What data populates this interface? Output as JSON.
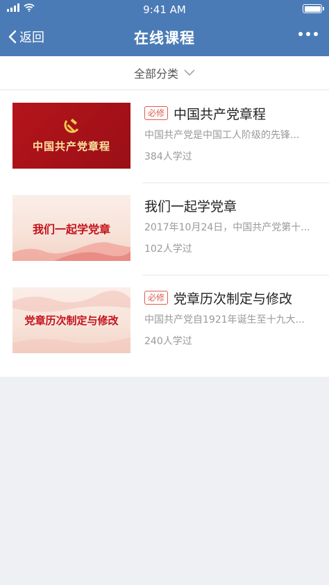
{
  "status": {
    "time": "9:41 AM"
  },
  "nav": {
    "back_label": "返回",
    "title": "在线课程"
  },
  "filter": {
    "label": "全部分类"
  },
  "courses": [
    {
      "thumb_text": "中国共产党章程",
      "badge": "必修",
      "title": "中国共产党章程",
      "desc": "中国共产党是中国工人阶级的先锋...",
      "count": "384人学过"
    },
    {
      "thumb_text": "我们一起学党章",
      "badge": "",
      "title": "我们一起学党章",
      "desc": "2017年10月24日，中国共产党第十...",
      "count": "102人学过"
    },
    {
      "thumb_text": "党章历次制定与修改",
      "badge": "必修",
      "title": "党章历次制定与修改",
      "desc": "中国共产党自1921年诞生至十九大...",
      "count": "240人学过"
    }
  ],
  "colors": {
    "header": "#4a7bb6",
    "badge": "#e05a4e",
    "emblem_red": "#b5141c"
  },
  "icons": [
    "signal-icon",
    "wifi-icon",
    "battery-icon",
    "back-chevron-icon",
    "more-dots-icon",
    "chevron-down-icon",
    "hammer-sickle-icon"
  ]
}
